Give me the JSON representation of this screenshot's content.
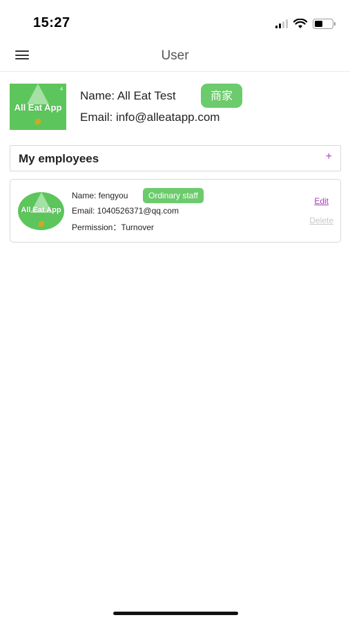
{
  "status_bar": {
    "time": "15:27",
    "icons": [
      "signal-icon",
      "wifi-icon",
      "battery-icon"
    ],
    "battery_level": 0.45
  },
  "nav": {
    "title": "User",
    "menu_icon": "hamburger-menu-icon"
  },
  "profile": {
    "logo_text": "All Eat App",
    "name": "Name: All Eat Test",
    "badge": "商家",
    "email": "Email: info@alleatapp.com"
  },
  "employees": {
    "title": "My employees",
    "add_label": "+",
    "list": [
      {
        "logo_text": "All Eat App",
        "name": "Name: fengyou",
        "role": "Ordinary staff",
        "email": "Email: 1040526371@qq.com",
        "permission": "Permission：Turnover",
        "edit_label": "Edit",
        "delete_label": "Delete"
      }
    ]
  },
  "colors": {
    "accent_green": "#6ccb6c",
    "link_purple": "#a63bb8",
    "muted_gray": "#c8c8c8"
  }
}
